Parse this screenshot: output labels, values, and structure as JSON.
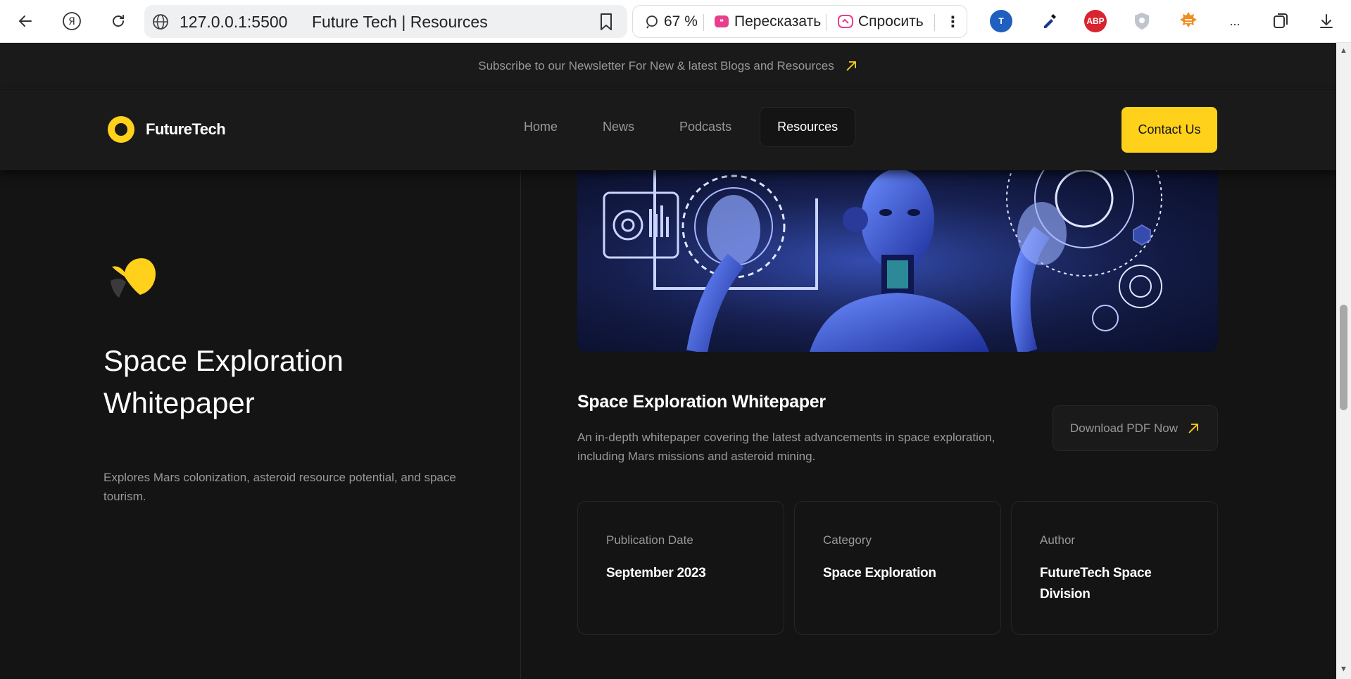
{
  "browser": {
    "url": "127.0.0.1:5500",
    "tab_title": "Future Tech | Resources",
    "zoom": "67 %",
    "retell_label": "Пересказать",
    "ask_label": "Спросить",
    "more_label": "...",
    "abp_label": "ABP"
  },
  "news_strip": {
    "text": "Subscribe to our Newsletter For New & latest Blogs and Resources"
  },
  "header": {
    "brand": "FutureTech",
    "nav": [
      "Home",
      "News",
      "Podcasts",
      "Resources"
    ],
    "active_nav": "Resources",
    "contact_label": "Contact Us",
    "accent": "#ffd11a"
  },
  "left": {
    "title": "Space Exploration Whitepaper",
    "description": "Explores Mars colonization, asteroid resource potential, and space tourism."
  },
  "resource": {
    "title": "Space Exploration Whitepaper",
    "description": "An in-depth whitepaper covering the latest advancements in space exploration, including Mars missions and asteroid mining.",
    "download_label": "Download PDF Now"
  },
  "meta": [
    {
      "label": "Publication Date",
      "value": "September 2023"
    },
    {
      "label": "Category",
      "value": "Space Exploration"
    },
    {
      "label": "Author",
      "value": "FutureTech Space Division"
    }
  ]
}
